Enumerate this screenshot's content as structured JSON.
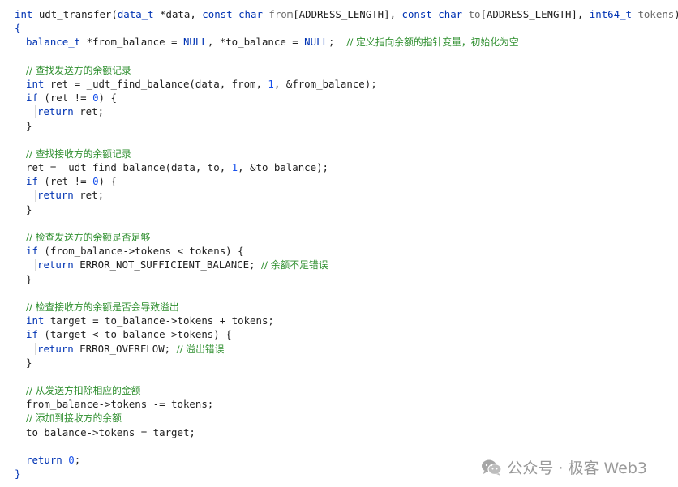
{
  "code_lines": [
    {
      "indent": 0,
      "tokens": [
        [
          "type",
          "int"
        ],
        [
          "fn",
          " udt_transfer("
        ],
        [
          "type",
          "data_t"
        ],
        [
          "fn",
          " *data, "
        ],
        [
          "kw",
          "const"
        ],
        [
          "fn",
          " "
        ],
        [
          "type",
          "char"
        ],
        [
          "dim",
          " from"
        ],
        [
          "fn",
          "[ADDRESS_LENGTH], "
        ],
        [
          "kw",
          "const"
        ],
        [
          "fn",
          " "
        ],
        [
          "type",
          "char"
        ],
        [
          "dim",
          " to"
        ],
        [
          "fn",
          "[ADDRESS_LENGTH], "
        ],
        [
          "type",
          "int64_t"
        ],
        [
          "dim",
          " tokens"
        ],
        [
          "fn",
          ")"
        ]
      ]
    },
    {
      "indent": 0,
      "tokens": [
        [
          "brace",
          "{"
        ]
      ]
    },
    {
      "indent": 1,
      "tokens": [
        [
          "type",
          "balance_t"
        ],
        [
          "fn",
          " *from_balance = "
        ],
        [
          "kw",
          "NULL"
        ],
        [
          "fn",
          ", *to_balance = "
        ],
        [
          "kw",
          "NULL"
        ],
        [
          "fn",
          ";  "
        ],
        [
          "cm",
          "// 定义指向余额的指针变量，初始化为空"
        ]
      ]
    },
    {
      "indent": 1,
      "tokens": []
    },
    {
      "indent": 1,
      "tokens": [
        [
          "cm",
          "// 查找发送方的余额记录"
        ]
      ]
    },
    {
      "indent": 1,
      "tokens": [
        [
          "type",
          "int"
        ],
        [
          "fn",
          " ret = _udt_find_balance(data, from, "
        ],
        [
          "num",
          "1"
        ],
        [
          "fn",
          ", &from_balance);"
        ]
      ]
    },
    {
      "indent": 1,
      "tokens": [
        [
          "kw",
          "if"
        ],
        [
          "fn",
          " (ret != "
        ],
        [
          "num",
          "0"
        ],
        [
          "fn",
          ") {"
        ]
      ]
    },
    {
      "indent": 2,
      "tokens": [
        [
          "kw",
          "return"
        ],
        [
          "fn",
          " ret;"
        ]
      ]
    },
    {
      "indent": 1,
      "tokens": [
        [
          "fn",
          "}"
        ]
      ]
    },
    {
      "indent": 1,
      "tokens": []
    },
    {
      "indent": 1,
      "tokens": [
        [
          "cm",
          "// 查找接收方的余额记录"
        ]
      ]
    },
    {
      "indent": 1,
      "tokens": [
        [
          "fn",
          "ret = _udt_find_balance(data, to, "
        ],
        [
          "num",
          "1"
        ],
        [
          "fn",
          ", &to_balance);"
        ]
      ]
    },
    {
      "indent": 1,
      "tokens": [
        [
          "kw",
          "if"
        ],
        [
          "fn",
          " (ret != "
        ],
        [
          "num",
          "0"
        ],
        [
          "fn",
          ") {"
        ]
      ]
    },
    {
      "indent": 2,
      "tokens": [
        [
          "kw",
          "return"
        ],
        [
          "fn",
          " ret;"
        ]
      ]
    },
    {
      "indent": 1,
      "tokens": [
        [
          "fn",
          "}"
        ]
      ]
    },
    {
      "indent": 1,
      "tokens": []
    },
    {
      "indent": 1,
      "tokens": [
        [
          "cm",
          "// 检查发送方的余额是否足够"
        ]
      ]
    },
    {
      "indent": 1,
      "tokens": [
        [
          "kw",
          "if"
        ],
        [
          "fn",
          " (from_balance->tokens < tokens) {"
        ]
      ]
    },
    {
      "indent": 2,
      "tokens": [
        [
          "kw",
          "return"
        ],
        [
          "fn",
          " ERROR_NOT_SUFFICIENT_BALANCE; "
        ],
        [
          "cm",
          "// 余额不足错误"
        ]
      ]
    },
    {
      "indent": 1,
      "tokens": [
        [
          "fn",
          "}"
        ]
      ]
    },
    {
      "indent": 1,
      "tokens": []
    },
    {
      "indent": 1,
      "tokens": [
        [
          "cm",
          "// 检查接收方的余额是否会导致溢出"
        ]
      ]
    },
    {
      "indent": 1,
      "tokens": [
        [
          "type",
          "int"
        ],
        [
          "fn",
          " target = to_balance->tokens + tokens;"
        ]
      ]
    },
    {
      "indent": 1,
      "tokens": [
        [
          "kw",
          "if"
        ],
        [
          "fn",
          " (target < to_balance->tokens) {"
        ]
      ]
    },
    {
      "indent": 2,
      "tokens": [
        [
          "kw",
          "return"
        ],
        [
          "fn",
          " ERROR_OVERFLOW; "
        ],
        [
          "cm",
          "// 溢出错误"
        ]
      ]
    },
    {
      "indent": 1,
      "tokens": [
        [
          "fn",
          "}"
        ]
      ]
    },
    {
      "indent": 1,
      "tokens": []
    },
    {
      "indent": 1,
      "tokens": [
        [
          "cm",
          "// 从发送方扣除相应的金额"
        ]
      ]
    },
    {
      "indent": 1,
      "tokens": [
        [
          "fn",
          "from_balance->tokens -= tokens;"
        ]
      ]
    },
    {
      "indent": 1,
      "tokens": [
        [
          "cm",
          "// 添加到接收方的余额"
        ]
      ]
    },
    {
      "indent": 1,
      "tokens": [
        [
          "fn",
          "to_balance->tokens = target;"
        ]
      ]
    },
    {
      "indent": 1,
      "tokens": []
    },
    {
      "indent": 1,
      "tokens": [
        [
          "kw",
          "return"
        ],
        [
          "fn",
          " "
        ],
        [
          "num",
          "0"
        ],
        [
          "fn",
          ";"
        ]
      ]
    },
    {
      "indent": 0,
      "tokens": [
        [
          "brace",
          "}"
        ]
      ]
    }
  ],
  "watermark": {
    "text": "公众号 · 极客 Web3",
    "icon": "wechat-icon"
  }
}
